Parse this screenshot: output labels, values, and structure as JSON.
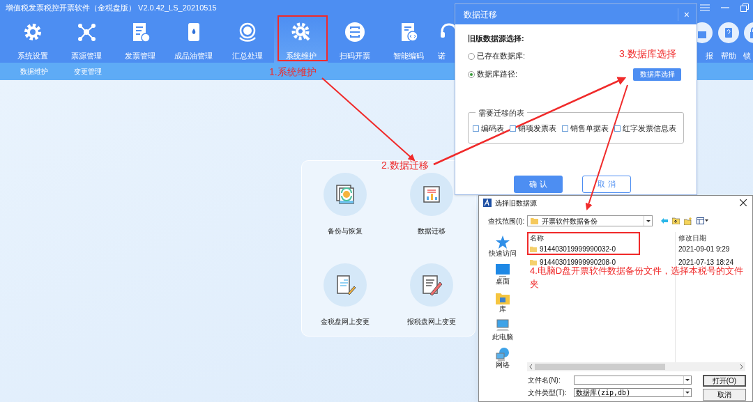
{
  "app": {
    "title": "增值税发票税控开票软件（金税盘版） V2.0.42_LS_20210515"
  },
  "toolbar": [
    {
      "label": "系统设置",
      "selected": false
    },
    {
      "label": "票源管理",
      "selected": false
    },
    {
      "label": "发票管理",
      "selected": false
    },
    {
      "label": "成品油管理",
      "selected": false
    },
    {
      "label": "汇总处理",
      "selected": false
    },
    {
      "label": "系统维护",
      "selected": true
    },
    {
      "label": "扫码开票",
      "selected": false
    },
    {
      "label": "智能编码",
      "selected": false
    },
    {
      "label": "诺",
      "selected": false
    }
  ],
  "toolbar_right": [
    {
      "label": "报"
    },
    {
      "label": "帮助"
    },
    {
      "label": "锁"
    }
  ],
  "subnav": [
    {
      "label": "数据维护"
    },
    {
      "label": "变更管理"
    }
  ],
  "functions": [
    {
      "label": "备份与恢复"
    },
    {
      "label": "数据迁移"
    },
    {
      "label": "金税盘网上变更"
    },
    {
      "label": "报税盘网上变更"
    }
  ],
  "migrate_dialog": {
    "title": "数据迁移",
    "close": "×",
    "section": "旧版数据源选择:",
    "options": [
      {
        "label": "已存在数据库:",
        "selected": false
      },
      {
        "label": "数据库路径:",
        "selected": true
      }
    ],
    "choose_button": "数据库选择",
    "tables_legend": "需要迁移的表",
    "tables": [
      {
        "label": "编码表",
        "checked": false
      },
      {
        "label": "销项发票表",
        "checked": false
      },
      {
        "label": "销售单据表",
        "checked": false
      },
      {
        "label": "红字发票信息表",
        "checked": false
      }
    ],
    "ok": "确 认",
    "cancel": "取 消"
  },
  "file_dialog": {
    "title": "选择旧数据源",
    "look_in_label": "查找范围(I):",
    "look_in": "开票软件数据备份",
    "places": [
      {
        "label": "快速访问"
      },
      {
        "label": "桌面"
      },
      {
        "label": "库"
      },
      {
        "label": "此电脑"
      },
      {
        "label": "网络"
      }
    ],
    "columns": [
      "名称",
      "修改日期"
    ],
    "rows": [
      {
        "name": "914403019999990032-0",
        "date": "2021-09-01 9:29"
      },
      {
        "name": "914403019999990208-0",
        "date": "2021-07-13 18:24"
      }
    ],
    "filename_label": "文件名(N):",
    "filetype_label": "文件类型(T):",
    "filetype": "数据库(zip,db)",
    "open": "打开(O)",
    "cancel": "取消"
  },
  "annotations": [
    {
      "text": "1.系统维护"
    },
    {
      "text": "2.数据迁移"
    },
    {
      "text": "3.数据库选择"
    },
    {
      "text": "4.电脑D盘开票软件数据备份文件，选择本税号的文件夹"
    }
  ]
}
